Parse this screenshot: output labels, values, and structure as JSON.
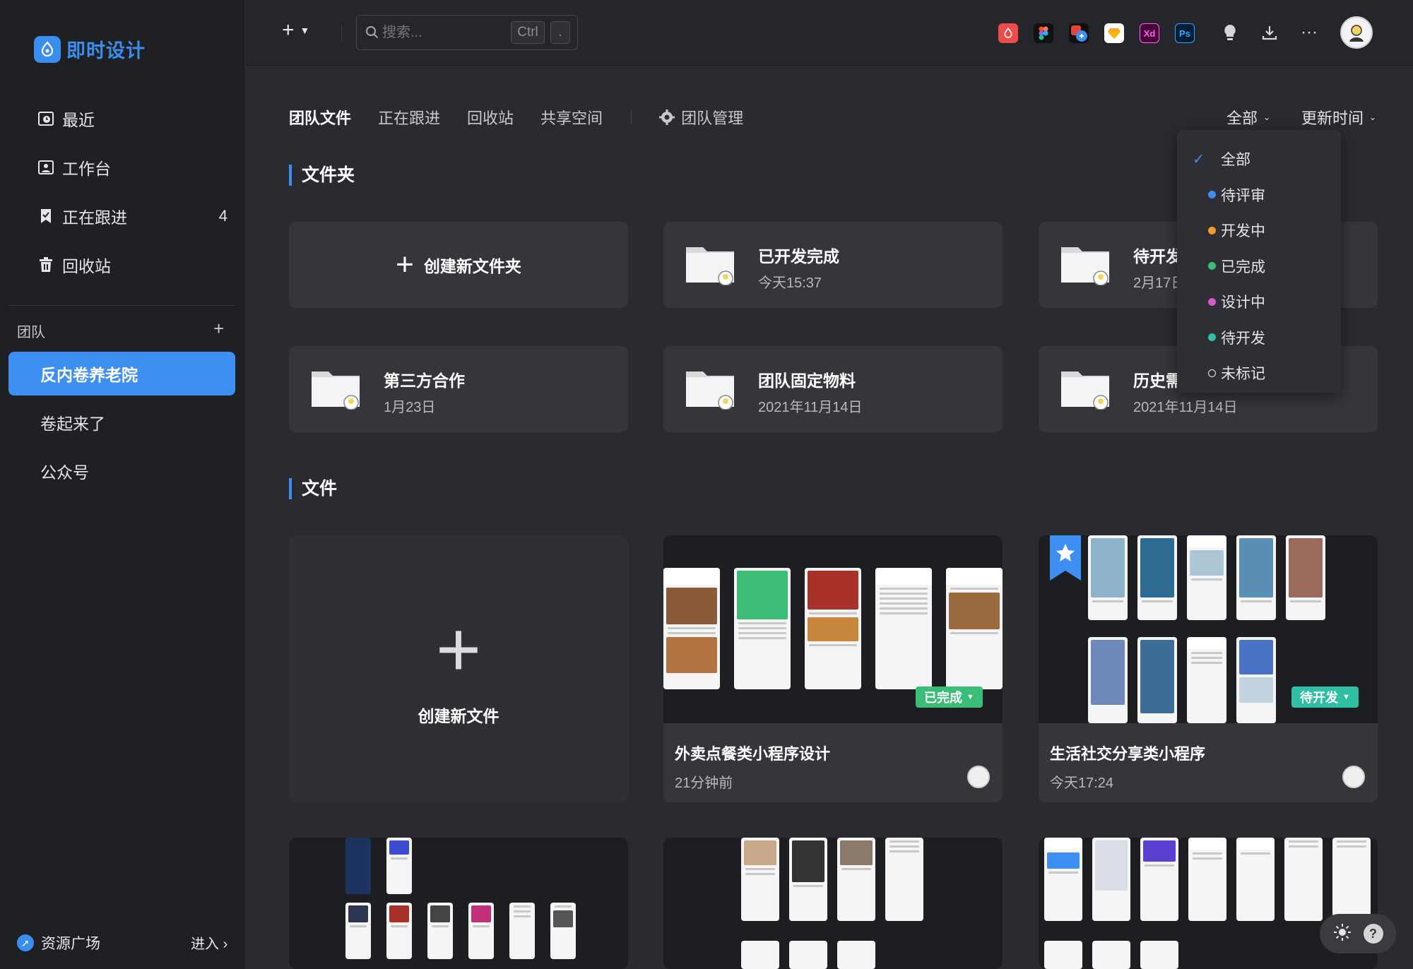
{
  "app": {
    "name": "即时设计"
  },
  "sidebar": {
    "nav": [
      {
        "label": "最近",
        "icon": "recent-icon"
      },
      {
        "label": "工作台",
        "icon": "workspace-icon"
      },
      {
        "label": "正在跟进",
        "icon": "following-icon",
        "count": "4"
      },
      {
        "label": "回收站",
        "icon": "trash-icon"
      }
    ],
    "team_label": "团队",
    "teams": [
      {
        "label": "反内卷养老院",
        "active": true
      },
      {
        "label": "卷起来了"
      },
      {
        "label": "公众号"
      }
    ],
    "resource_plaza": "资源广场",
    "enter": "进入"
  },
  "topbar": {
    "search_placeholder": "搜索...",
    "kbd_ctrl": "Ctrl",
    "kbd_dot": ".",
    "app_icons": [
      "fire-app-icon",
      "figma-icon",
      "multi-link-icon",
      "sketch-icon",
      "xd-icon",
      "photoshop-icon"
    ]
  },
  "tabs": {
    "items": [
      "团队文件",
      "正在跟进",
      "回收站",
      "共享空间"
    ],
    "manage": "团队管理"
  },
  "filters": {
    "status": "全部",
    "sort": "更新时间"
  },
  "sections": {
    "folders": "文件夹",
    "files": "文件"
  },
  "folders": {
    "create": "创建新文件夹",
    "items": [
      {
        "name": "已开发完成",
        "date": "今天15:37"
      },
      {
        "name": "待开发",
        "date": "2月17日"
      },
      {
        "name": "第三方合作",
        "date": "1月23日"
      },
      {
        "name": "团队固定物料",
        "date": "2021年11月14日"
      },
      {
        "name": "历史需求",
        "date": "2021年11月14日"
      }
    ]
  },
  "files": {
    "create": "创建新文件",
    "items": [
      {
        "title": "外卖点餐类小程序设计",
        "time": "21分钟前",
        "status": "已完成"
      },
      {
        "title": "生活社交分享类小程序",
        "time": "今天17:24",
        "status": "待开发"
      }
    ]
  },
  "dropdown": {
    "items": [
      {
        "label": "全部",
        "checked": true
      },
      {
        "label": "待评审",
        "color": "#3e8ff2"
      },
      {
        "label": "开发中",
        "color": "#f39a2b"
      },
      {
        "label": "已完成",
        "color": "#3bbd77"
      },
      {
        "label": "设计中",
        "color": "#d957c6"
      },
      {
        "label": "待开发",
        "color": "#2fbfa3"
      },
      {
        "label": "未标记",
        "color": "none"
      }
    ]
  },
  "colors": {
    "accent": "#3e8ff2",
    "done": "#3bbd77"
  }
}
